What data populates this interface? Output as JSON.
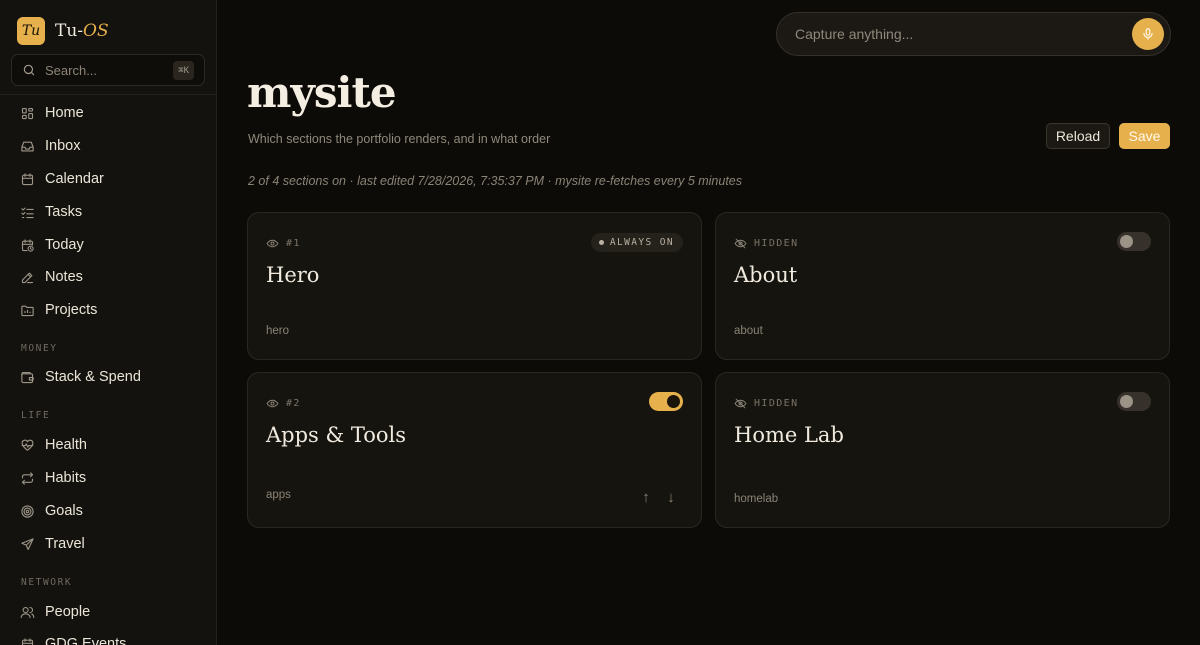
{
  "app": {
    "logo_text": "Tu",
    "name_prefix": "Tu-",
    "name_accent": "OS"
  },
  "sidebar": {
    "search_placeholder": "Search...",
    "shortcut": "⌘K",
    "items": [
      {
        "label": "Home",
        "icon": "grid-icon"
      },
      {
        "label": "Inbox",
        "icon": "inbox-icon"
      },
      {
        "label": "Calendar",
        "icon": "calendar-icon"
      },
      {
        "label": "Tasks",
        "icon": "checklist-icon"
      },
      {
        "label": "Today",
        "icon": "calendar-clock-icon"
      },
      {
        "label": "Notes",
        "icon": "pencil-icon"
      },
      {
        "label": "Projects",
        "icon": "folder-icon"
      }
    ],
    "sections": {
      "money": {
        "title": "MONEY",
        "items": [
          {
            "label": "Stack & Spend",
            "icon": "wallet-icon"
          }
        ]
      },
      "life": {
        "title": "LIFE",
        "items": [
          {
            "label": "Health",
            "icon": "heart-pulse-icon"
          },
          {
            "label": "Habits",
            "icon": "repeat-icon"
          },
          {
            "label": "Goals",
            "icon": "target-icon"
          },
          {
            "label": "Travel",
            "icon": "plane-icon"
          }
        ]
      },
      "network": {
        "title": "NETWORK",
        "items": [
          {
            "label": "People",
            "icon": "users-icon"
          },
          {
            "label": "GDG Events",
            "icon": "calendar-icon"
          }
        ]
      }
    }
  },
  "capture": {
    "placeholder": "Capture anything..."
  },
  "page": {
    "title": "mysite",
    "subtitle": "Which sections the portfolio renders, and in what order",
    "status": "2 of 4 sections on · last edited 7/28/2026, 7:35:37 PM · mysite re-fetches every 5 minutes",
    "reload_label": "Reload",
    "save_label": "Save"
  },
  "sections": [
    {
      "order": "#1",
      "title": "Hero",
      "slug": "hero",
      "badge": "ALWAYS ON",
      "visible": true
    },
    {
      "order": "HIDDEN",
      "title": "About",
      "slug": "about",
      "visible": false,
      "enabled": false
    },
    {
      "order": "#2",
      "title": "Apps & Tools",
      "slug": "apps",
      "visible": true,
      "enabled": true,
      "move_up": "↑",
      "move_down": "↓"
    },
    {
      "order": "HIDDEN",
      "title": "Home Lab",
      "slug": "homelab",
      "visible": false,
      "enabled": false
    }
  ],
  "colors": {
    "accent": "#e6b14d",
    "background": "#0d0b08",
    "card": "#16140f"
  }
}
